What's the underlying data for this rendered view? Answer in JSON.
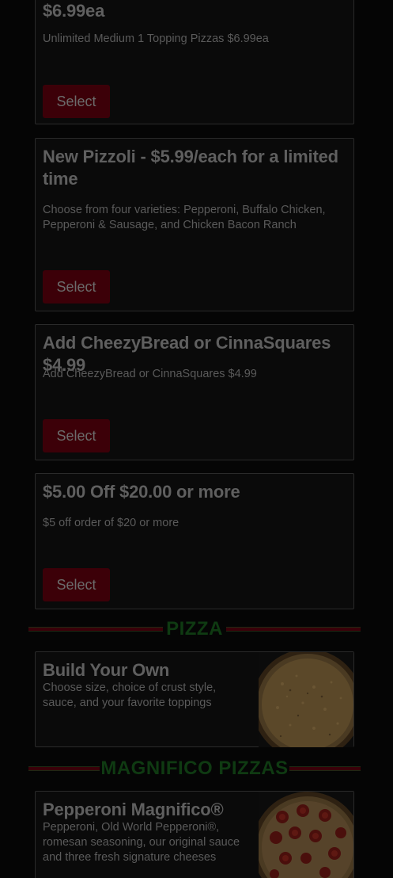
{
  "deals": [
    {
      "title": "$6.99ea",
      "description": "Unlimited Medium 1 Topping Pizzas $6.99ea",
      "button": "Select"
    },
    {
      "title": "New Pizzoli - $5.99/each for a limited time",
      "description": "Choose from four varieties: Pepperoni, Buffalo Chicken, Pepperoni & Sausage, and Chicken Bacon Ranch",
      "button": "Select"
    },
    {
      "title": "Add CheezyBread or CinnaSquares $4.99",
      "description": "Add CheezyBread or CinnaSquares $4.99",
      "button": "Select"
    },
    {
      "title": "$5.00 Off $20.00 or more",
      "description": "$5 off order of $20 or more",
      "button": "Select"
    }
  ],
  "sections": {
    "pizza": {
      "heading": "PIZZA",
      "items": [
        {
          "title": "Build Your Own",
          "description": "Choose size, choice of crust style, sauce, and your favorite toppings",
          "image_icon": "cheese-pizza-image"
        }
      ]
    },
    "magnifico": {
      "heading": "MAGNIFICO PIZZAS",
      "items": [
        {
          "title": "Pepperoni Magnifico®",
          "description": "Pepperoni, Old World Pepperoni®, romesan seasoning, our original sauce and three fresh signature cheeses",
          "image_icon": "pepperoni-pizza-image"
        }
      ]
    }
  },
  "colors": {
    "background": "#050505",
    "button_bg": "#3c0008",
    "section_heading": "#0f3a12",
    "rule": "#3a0009"
  }
}
